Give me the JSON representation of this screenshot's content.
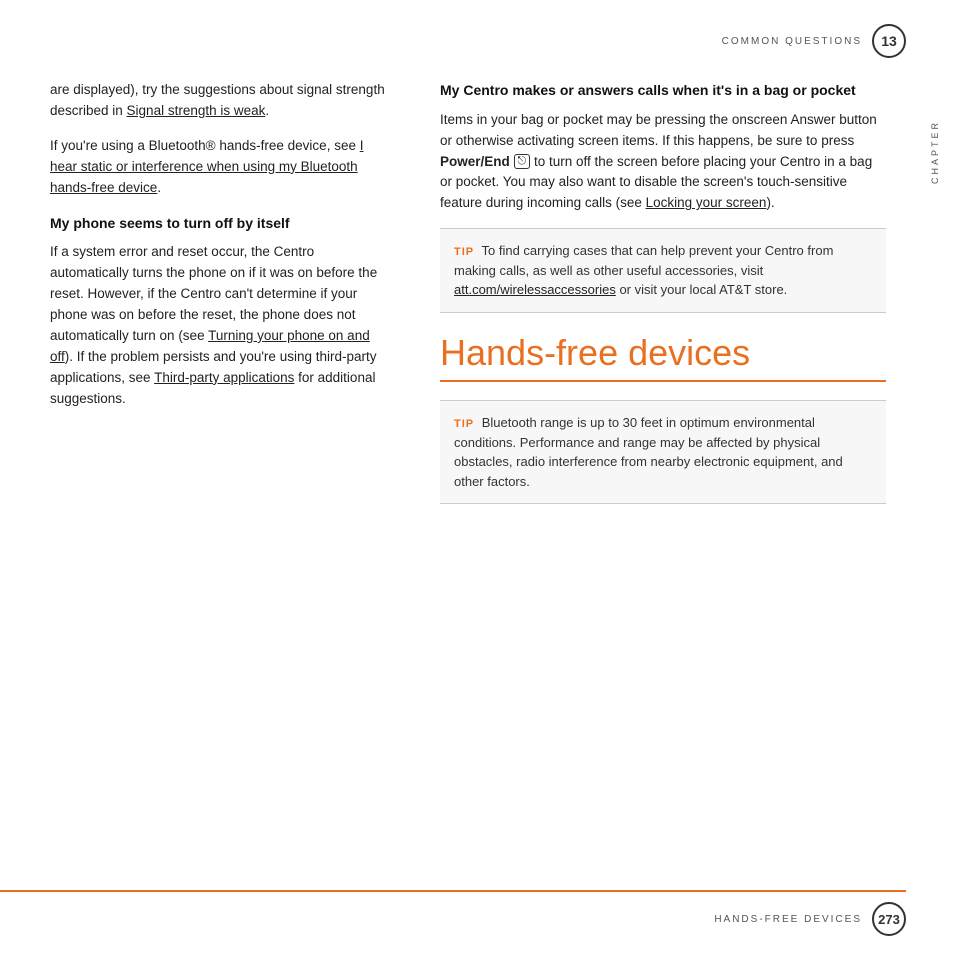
{
  "header": {
    "section_label": "COMMON QUESTIONS",
    "chapter_number": "13"
  },
  "chapter_side": "CHAPTER",
  "left_column": {
    "para1": "are displayed), try the suggestions about signal strength described in ",
    "para1_link": "Signal strength is weak",
    "para1_end": ".",
    "para2_start": "If you're using a Bluetooth® hands-free device, see ",
    "para2_link": "I hear static or interference when using my Bluetooth hands-free device",
    "para2_end": ".",
    "section1_heading": "My phone seems to turn off by itself",
    "section1_body": "If a system error and reset occur, the Centro automatically turns the phone on if it was on before the reset. However, if the Centro can't determine if your phone was on before the reset, the phone does not automatically turn on (see ",
    "section1_link1": "Turning your phone on and off",
    "section1_mid": "). If the problem persists and you're using third-party applications, see ",
    "section1_link2": "Third-party applications",
    "section1_end": " for additional suggestions."
  },
  "right_column": {
    "section2_heading": "My Centro makes or answers calls when it's in a bag or pocket",
    "section2_body1": "Items in your bag or pocket may be pressing the onscreen Answer button or otherwise activating screen items. If this happens, be sure to press ",
    "section2_bold": "Power/End",
    "section2_icon": "⏻",
    "section2_body2": " to turn off the screen before placing your Centro in a bag or pocket. You may also want to disable the screen's touch-sensitive feature during incoming calls (see ",
    "section2_link": "Locking your screen",
    "section2_end": ").",
    "tip1_label": "TIP",
    "tip1_text": " To find carrying cases that can help prevent your Centro from making calls, as well as other useful accessories, visit ",
    "tip1_link": "att.com/wirelessaccessories",
    "tip1_end": " or visit your local AT&T store.",
    "section3_title": "Hands-free devices",
    "tip2_label": "TIP",
    "tip2_text": " Bluetooth range is up to 30 feet in optimum environmental conditions. Performance and range may be affected by physical obstacles, radio interference from nearby electronic equipment, and other factors."
  },
  "footer": {
    "label": "HANDS-FREE DEVICES",
    "page_number": "273"
  }
}
